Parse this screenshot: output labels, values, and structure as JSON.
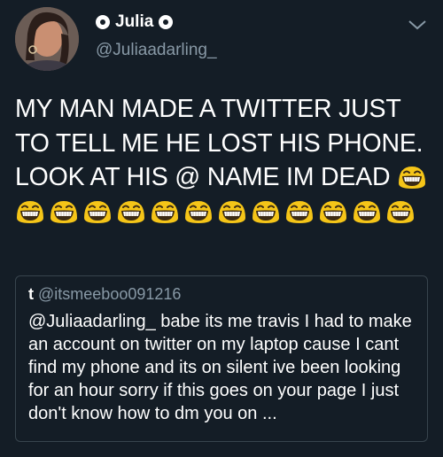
{
  "author": {
    "display_name": "Julia",
    "handle": "@Juliaadarling_",
    "avatar_icon": "profile-photo"
  },
  "tweet": {
    "text": "MY MAN MADE A TWITTER JUST TO TELL ME HE LOST HIS PHONE. LOOK AT HIS @ NAME IM DEAD",
    "emoji_count": 13,
    "emoji_icon": "grinning-squinting-face"
  },
  "quoted_tweet": {
    "author_name": "t",
    "author_handle": "@itsmeeboo091216",
    "text": "@Juliaadarling_ babe its me travis I had to make an account on twitter on my laptop cause I cant find my phone and its on silent ive been looking for an hour sorry if this goes on your page I just don't know how to dm you on ..."
  },
  "colors": {
    "background": "#141d26",
    "secondary_text": "#8899a6",
    "border": "#38444d",
    "emoji_yellow": "#f5c518"
  }
}
